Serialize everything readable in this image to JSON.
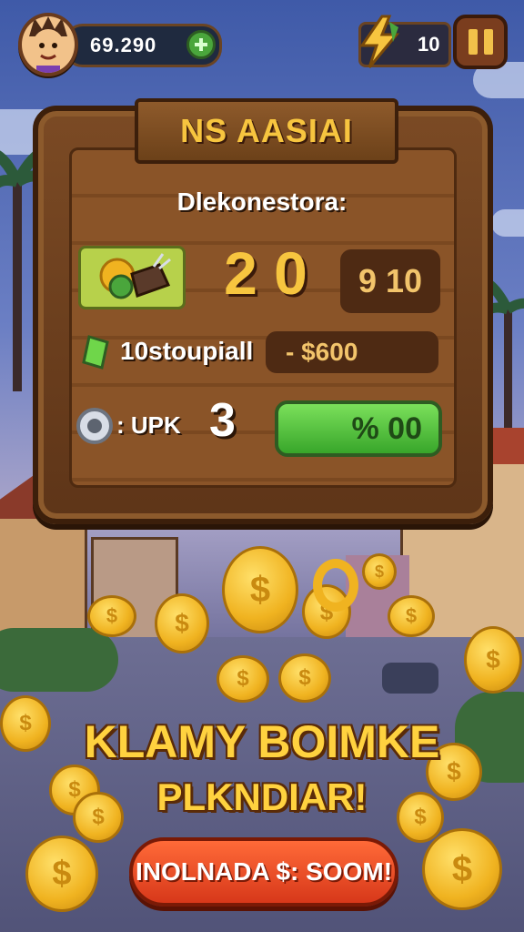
{
  "hud": {
    "coins_value": "69.290",
    "energy_value": "10",
    "icons": [
      "avatar",
      "plus-icon",
      "lightning-icon",
      "pause-icon"
    ]
  },
  "panel": {
    "banner_title": "NS AASIAI",
    "subtitle": "Dlekonestora:",
    "big_score": "2 0",
    "score_box": "9 10",
    "row2_label": "10stoupiall",
    "row2_value": "- $600",
    "row3_label": ": UPK",
    "row3_number": "3",
    "green_value": "% 00"
  },
  "promo": {
    "line1": "KLAMY BOIMKE",
    "line2": "PLKNDIAR!",
    "cta_label": "INOLNADA $: SOOM!"
  },
  "colors": {
    "gold": "#f7c53f",
    "wood": "#7b4a24",
    "green": "#4aa63c",
    "cta": "#ff6a38"
  }
}
